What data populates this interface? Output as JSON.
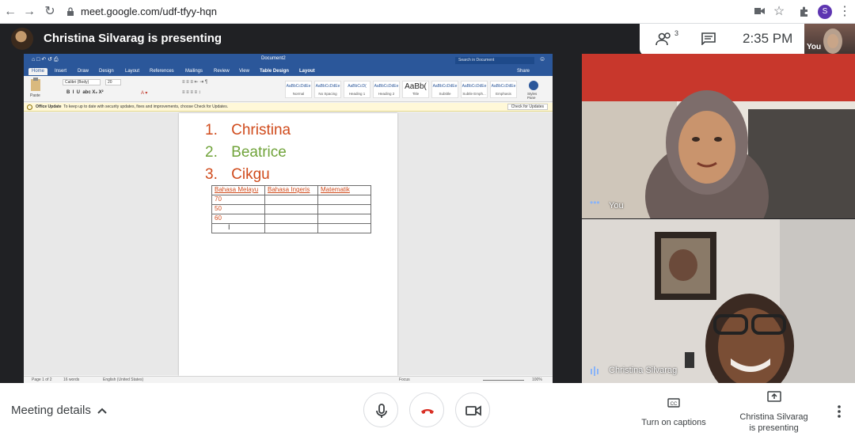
{
  "browser": {
    "url": "meet.google.com/udf-tfyy-hqn",
    "profile_initial": "S"
  },
  "meeting": {
    "presenting_title": "Christina Silvarag is presenting",
    "participants_count": "3",
    "time": "2:35 PM",
    "thumbnail_label": "You"
  },
  "word": {
    "doc_name": "Document2",
    "search_placeholder": "Search in Document",
    "tabs": [
      "Home",
      "Insert",
      "Draw",
      "Design",
      "Layout",
      "References",
      "Mailings",
      "Review",
      "View",
      "Table Design",
      "Layout"
    ],
    "share_label": "Share",
    "font_name": "Calibri (Body)",
    "font_size": "20",
    "styles": [
      {
        "sample": "AaBbCcDdEe",
        "name": "Normal"
      },
      {
        "sample": "AaBbCcDdEe",
        "name": "No Spacing"
      },
      {
        "sample": "AaBbCcD(",
        "name": "Heading 1"
      },
      {
        "sample": "AaBbCcDdEe",
        "name": "Heading 2"
      },
      {
        "sample": "AaBb(",
        "name": "Title"
      },
      {
        "sample": "AaBbCcDdEe",
        "name": "Subtitle"
      },
      {
        "sample": "AaBbCcDdEe",
        "name": "Subtle Emph..."
      },
      {
        "sample": "AaBbCcDdEe",
        "name": "Emphasis"
      }
    ],
    "styles_pane_label": "Styles Pane",
    "paste_label": "Paste",
    "update_title": "Office Update",
    "update_text": "To keep up to date with security updates, fixes and improvements, choose Check for Updates.",
    "update_button": "Check for Updates",
    "list_items": [
      {
        "num": "1.",
        "text": "Christina",
        "color": "#d04b1c"
      },
      {
        "num": "2.",
        "text": "Beatrice",
        "color": "#70a33a"
      },
      {
        "num": "3.",
        "text": "Cikgu",
        "color": "#d04b1c"
      }
    ],
    "table": {
      "headers": [
        "Bahasa Melayu",
        "Bahasa Ingeris",
        "Matematik"
      ],
      "rows": [
        [
          "70",
          "",
          ""
        ],
        [
          "50",
          "",
          ""
        ],
        [
          "60",
          "",
          ""
        ],
        [
          "",
          "",
          ""
        ]
      ]
    },
    "status": {
      "page": "Page 1 of 2",
      "words": "16 words",
      "language": "English (United States)",
      "focus": "Focus",
      "zoom": "100%"
    }
  },
  "tiles": [
    {
      "name": "You"
    },
    {
      "name": "Christina Silvarag"
    }
  ],
  "bottom": {
    "meeting_details": "Meeting details",
    "captions_label": "Turn on captions",
    "present_label": "Christina Silvarag is presenting"
  },
  "colors": {
    "hangup": "#d93025",
    "word_blue": "#2b579a"
  }
}
